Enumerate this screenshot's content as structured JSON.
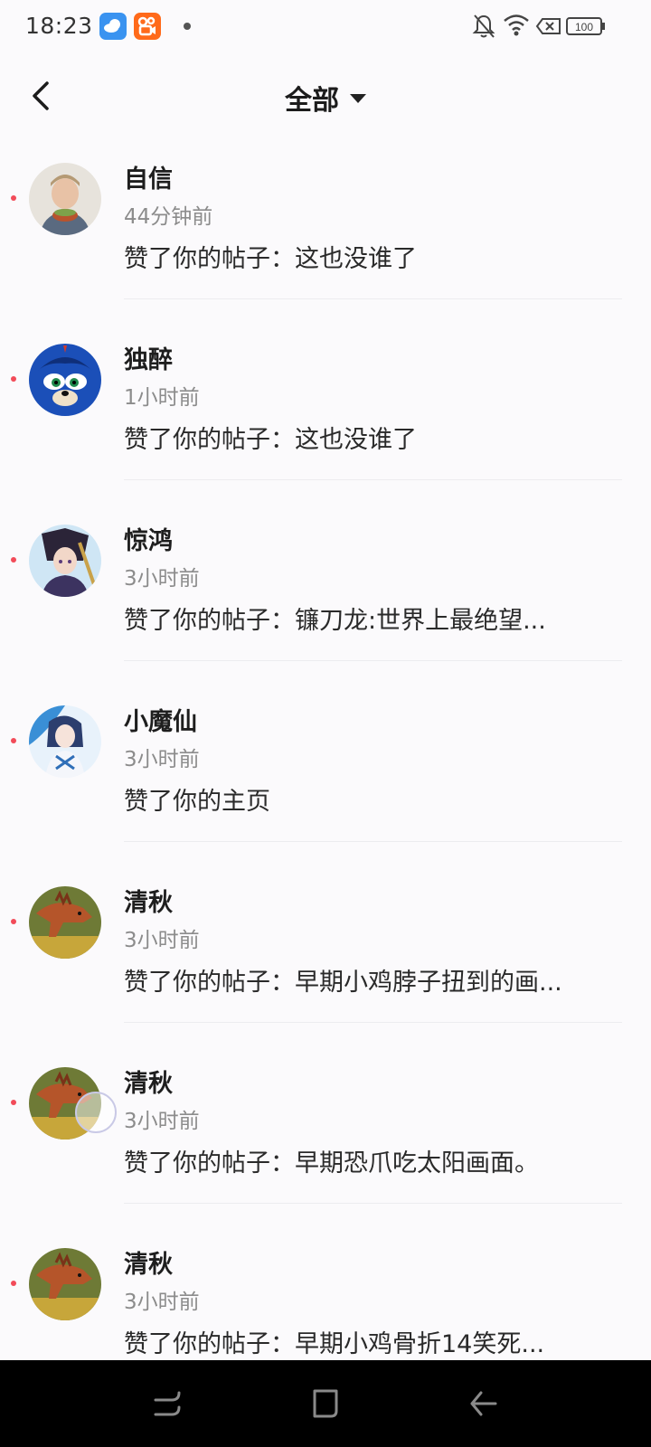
{
  "status_bar": {
    "time": "18:23",
    "icons": [
      "weather-app-icon",
      "kuaishou-app-icon",
      "notification-dot-icon",
      "bell-muted-icon",
      "wifi-icon",
      "sim-no-signal-icon",
      "battery-icon"
    ],
    "battery_level": "100"
  },
  "header": {
    "back_icon": "chevron-left-icon",
    "title": "全部",
    "dropdown_icon": "caret-down-icon"
  },
  "notifications": [
    {
      "name": "自信",
      "time": "44分钟前",
      "message": "赞了你的帖子：这也没谁了",
      "unread": true,
      "avatar": "avatar-man-holding-food"
    },
    {
      "name": "独醉",
      "time": "1小时前",
      "message": "赞了你的帖子：这也没谁了",
      "unread": true,
      "avatar": "avatar-blue-hedgehog"
    },
    {
      "name": "惊鸿",
      "time": "3小时前",
      "message": "赞了你的帖子：镰刀龙:世界上最绝望...",
      "unread": true,
      "avatar": "avatar-anime-warrior"
    },
    {
      "name": "小魔仙",
      "time": "3小时前",
      "message": "赞了你的主页",
      "unread": true,
      "avatar": "avatar-anime-girl-blue"
    },
    {
      "name": "清秋",
      "time": "3小时前",
      "message": "赞了你的帖子：早期小鸡脖子扭到的画...",
      "unread": true,
      "avatar": "avatar-dinosaur"
    },
    {
      "name": "清秋",
      "time": "3小时前",
      "message": "赞了你的帖子：早期恐爪吃太阳画面。",
      "unread": true,
      "avatar": "avatar-dinosaur"
    },
    {
      "name": "清秋",
      "time": "3小时前",
      "message": "赞了你的帖子：早期小鸡骨折14笑死...",
      "unread": true,
      "avatar": "avatar-dinosaur"
    }
  ],
  "colors": {
    "background": "#fbfafc",
    "unread_dot": "#f24b59",
    "secondary_text": "#8c8c8c",
    "nav_bar": "#000000"
  },
  "nav_bar": {
    "buttons": [
      "recent-apps-icon",
      "home-icon",
      "back-icon"
    ]
  }
}
